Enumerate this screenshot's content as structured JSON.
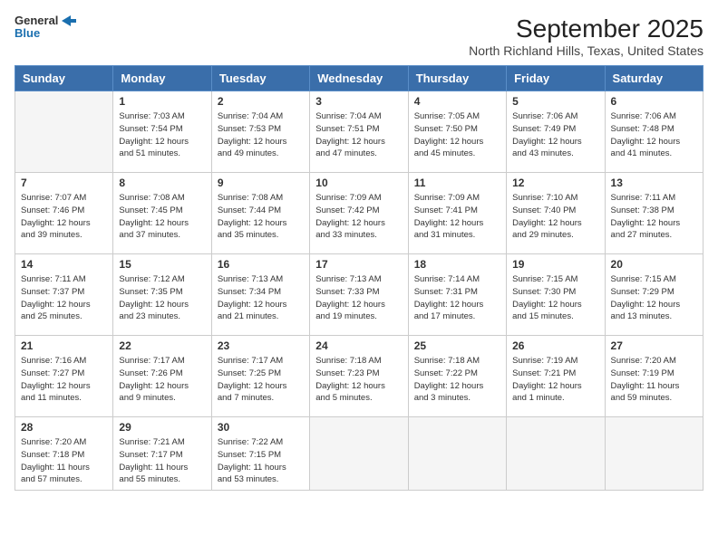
{
  "header": {
    "logo_line1": "General",
    "logo_line2": "Blue",
    "month_year": "September 2025",
    "location": "North Richland Hills, Texas, United States"
  },
  "days_of_week": [
    "Sunday",
    "Monday",
    "Tuesday",
    "Wednesday",
    "Thursday",
    "Friday",
    "Saturday"
  ],
  "weeks": [
    [
      {
        "num": "",
        "info": ""
      },
      {
        "num": "1",
        "info": "Sunrise: 7:03 AM\nSunset: 7:54 PM\nDaylight: 12 hours\nand 51 minutes."
      },
      {
        "num": "2",
        "info": "Sunrise: 7:04 AM\nSunset: 7:53 PM\nDaylight: 12 hours\nand 49 minutes."
      },
      {
        "num": "3",
        "info": "Sunrise: 7:04 AM\nSunset: 7:51 PM\nDaylight: 12 hours\nand 47 minutes."
      },
      {
        "num": "4",
        "info": "Sunrise: 7:05 AM\nSunset: 7:50 PM\nDaylight: 12 hours\nand 45 minutes."
      },
      {
        "num": "5",
        "info": "Sunrise: 7:06 AM\nSunset: 7:49 PM\nDaylight: 12 hours\nand 43 minutes."
      },
      {
        "num": "6",
        "info": "Sunrise: 7:06 AM\nSunset: 7:48 PM\nDaylight: 12 hours\nand 41 minutes."
      }
    ],
    [
      {
        "num": "7",
        "info": "Sunrise: 7:07 AM\nSunset: 7:46 PM\nDaylight: 12 hours\nand 39 minutes."
      },
      {
        "num": "8",
        "info": "Sunrise: 7:08 AM\nSunset: 7:45 PM\nDaylight: 12 hours\nand 37 minutes."
      },
      {
        "num": "9",
        "info": "Sunrise: 7:08 AM\nSunset: 7:44 PM\nDaylight: 12 hours\nand 35 minutes."
      },
      {
        "num": "10",
        "info": "Sunrise: 7:09 AM\nSunset: 7:42 PM\nDaylight: 12 hours\nand 33 minutes."
      },
      {
        "num": "11",
        "info": "Sunrise: 7:09 AM\nSunset: 7:41 PM\nDaylight: 12 hours\nand 31 minutes."
      },
      {
        "num": "12",
        "info": "Sunrise: 7:10 AM\nSunset: 7:40 PM\nDaylight: 12 hours\nand 29 minutes."
      },
      {
        "num": "13",
        "info": "Sunrise: 7:11 AM\nSunset: 7:38 PM\nDaylight: 12 hours\nand 27 minutes."
      }
    ],
    [
      {
        "num": "14",
        "info": "Sunrise: 7:11 AM\nSunset: 7:37 PM\nDaylight: 12 hours\nand 25 minutes."
      },
      {
        "num": "15",
        "info": "Sunrise: 7:12 AM\nSunset: 7:35 PM\nDaylight: 12 hours\nand 23 minutes."
      },
      {
        "num": "16",
        "info": "Sunrise: 7:13 AM\nSunset: 7:34 PM\nDaylight: 12 hours\nand 21 minutes."
      },
      {
        "num": "17",
        "info": "Sunrise: 7:13 AM\nSunset: 7:33 PM\nDaylight: 12 hours\nand 19 minutes."
      },
      {
        "num": "18",
        "info": "Sunrise: 7:14 AM\nSunset: 7:31 PM\nDaylight: 12 hours\nand 17 minutes."
      },
      {
        "num": "19",
        "info": "Sunrise: 7:15 AM\nSunset: 7:30 PM\nDaylight: 12 hours\nand 15 minutes."
      },
      {
        "num": "20",
        "info": "Sunrise: 7:15 AM\nSunset: 7:29 PM\nDaylight: 12 hours\nand 13 minutes."
      }
    ],
    [
      {
        "num": "21",
        "info": "Sunrise: 7:16 AM\nSunset: 7:27 PM\nDaylight: 12 hours\nand 11 minutes."
      },
      {
        "num": "22",
        "info": "Sunrise: 7:17 AM\nSunset: 7:26 PM\nDaylight: 12 hours\nand 9 minutes."
      },
      {
        "num": "23",
        "info": "Sunrise: 7:17 AM\nSunset: 7:25 PM\nDaylight: 12 hours\nand 7 minutes."
      },
      {
        "num": "24",
        "info": "Sunrise: 7:18 AM\nSunset: 7:23 PM\nDaylight: 12 hours\nand 5 minutes."
      },
      {
        "num": "25",
        "info": "Sunrise: 7:18 AM\nSunset: 7:22 PM\nDaylight: 12 hours\nand 3 minutes."
      },
      {
        "num": "26",
        "info": "Sunrise: 7:19 AM\nSunset: 7:21 PM\nDaylight: 12 hours\nand 1 minute."
      },
      {
        "num": "27",
        "info": "Sunrise: 7:20 AM\nSunset: 7:19 PM\nDaylight: 11 hours\nand 59 minutes."
      }
    ],
    [
      {
        "num": "28",
        "info": "Sunrise: 7:20 AM\nSunset: 7:18 PM\nDaylight: 11 hours\nand 57 minutes."
      },
      {
        "num": "29",
        "info": "Sunrise: 7:21 AM\nSunset: 7:17 PM\nDaylight: 11 hours\nand 55 minutes."
      },
      {
        "num": "30",
        "info": "Sunrise: 7:22 AM\nSunset: 7:15 PM\nDaylight: 11 hours\nand 53 minutes."
      },
      {
        "num": "",
        "info": ""
      },
      {
        "num": "",
        "info": ""
      },
      {
        "num": "",
        "info": ""
      },
      {
        "num": "",
        "info": ""
      }
    ]
  ]
}
